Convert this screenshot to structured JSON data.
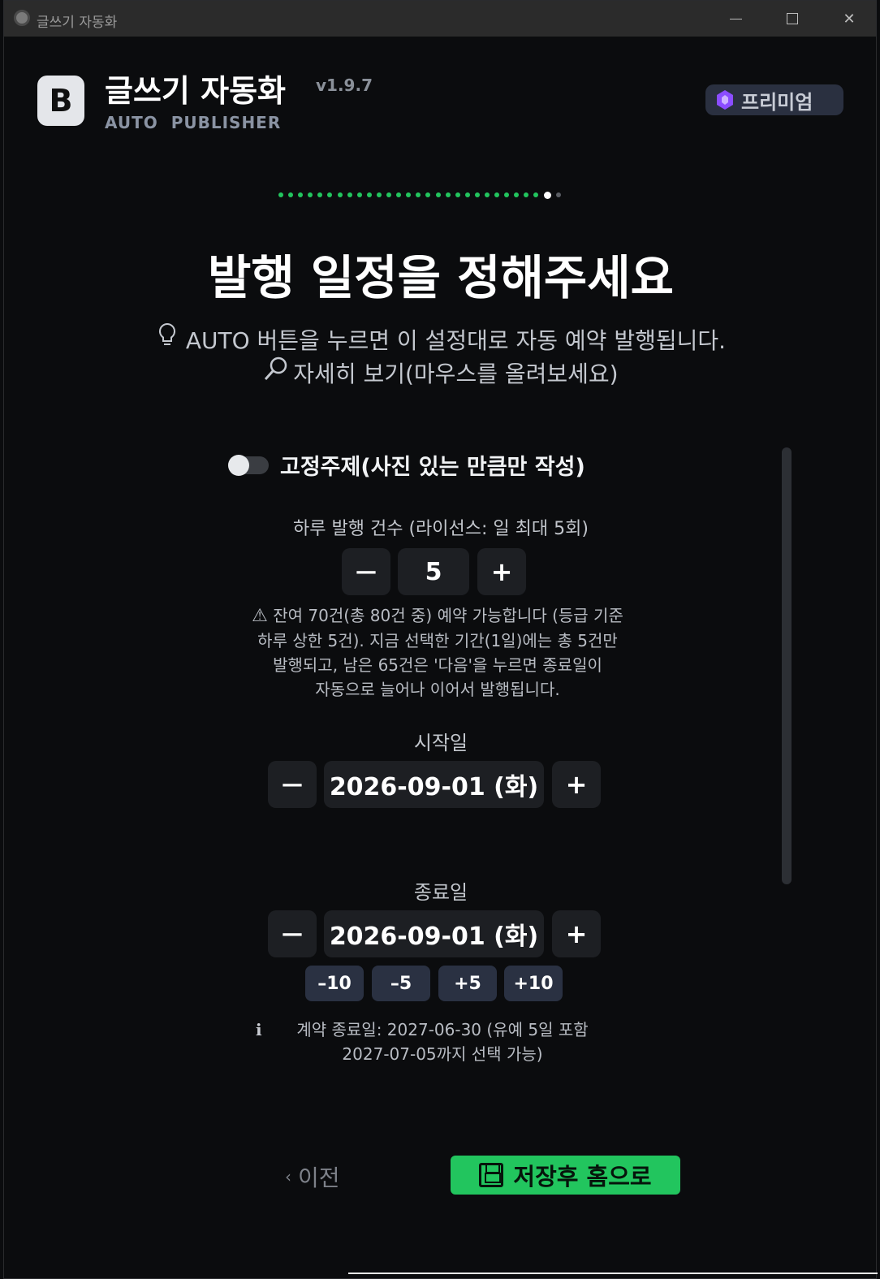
{
  "window": {
    "title": "글쓰기 자동화"
  },
  "header": {
    "logo_letter": "B",
    "app_name": "글쓰기 자동화",
    "version": "v1.9.7",
    "subtitle": "AUTO PUBLISHER",
    "premium_label": "프리미엄",
    "premium_color": "#8b4dff"
  },
  "progress": {
    "completed_steps": 27,
    "current_step": 28,
    "total_steps": 29,
    "accent": "#22c55e"
  },
  "main": {
    "title": "발행 일정을 정해주세요",
    "hint_auto": "AUTO 버튼을 누르면 이 설정대로 자동 예약 발행됩니다.",
    "hint_details": "자세히 보기(마우스를 올려보세요)",
    "fixed_topic": {
      "label": "고정주제(사진 있는 만큼만 작성)",
      "enabled": false
    },
    "daily_count": {
      "label": "하루 발행 건수 (라이선스: 일 최대 5회)",
      "minus": "—",
      "value": "5",
      "plus": "+"
    },
    "warning_lines": [
      "잔여 70건(총 80건 중) 예약 가능합니다 (등급 기준",
      "하루 상한 5건). 지금 선택한 기간(1일)에는 총 5건만",
      "발행되고, 남은 65건은 '다음'을 누르면 종료일이",
      "자동으로 늘어나 이어서 발행됩니다."
    ],
    "start_date": {
      "label": "시작일",
      "minus": "—",
      "value": "2026-09-01 (화)",
      "plus": "+"
    },
    "end_date": {
      "label": "종료일",
      "minus": "—",
      "value": "2026-09-01 (화)",
      "plus": "+"
    },
    "quick_adjust": [
      "–10",
      "–5",
      "+5",
      "+10"
    ],
    "info_lines": [
      "계약 종료일: 2027-06-30 (유예 5일 포함",
      "2027-07-05까지 선택 가능)"
    ]
  },
  "footer": {
    "prev_label": "이전",
    "save_label": "저장후 홈으로",
    "save_color": "#22c55e"
  }
}
